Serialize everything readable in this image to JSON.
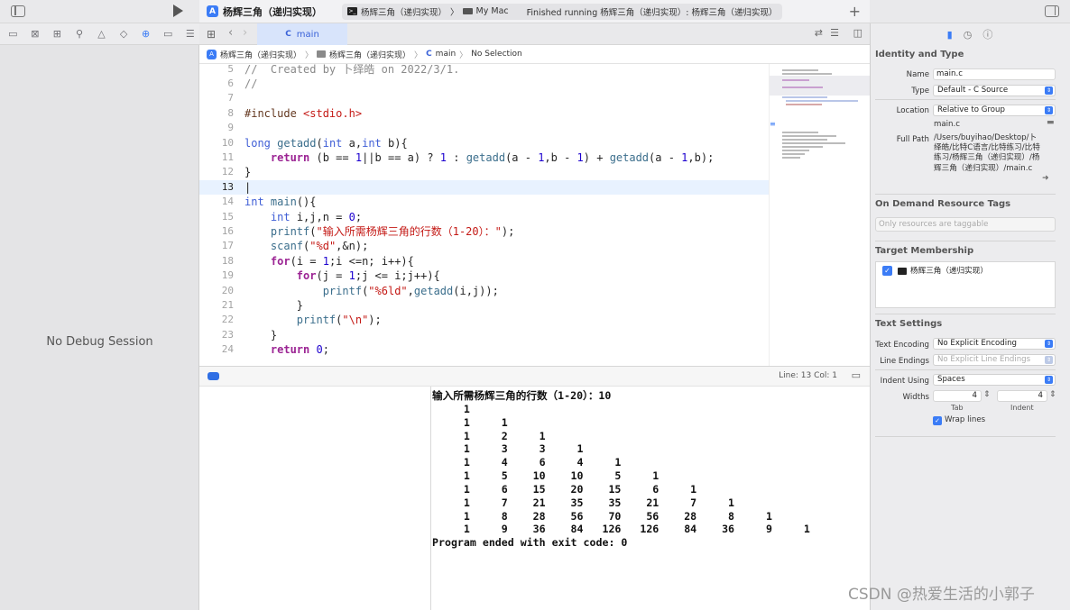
{
  "toolbar": {
    "project_name": "杨辉三角（递归实现）",
    "scheme_target": "杨辉三角（递归实现）",
    "device": "My Mac",
    "status": "Finished running 杨辉三角（递归实现）: 杨辉三角（递归实现）"
  },
  "left_panel": {
    "no_debug": "No Debug Session"
  },
  "tab": {
    "label": "main"
  },
  "jump_bar": {
    "project": "杨辉三角（递归实现）",
    "group": "杨辉三角（递归实现）",
    "file": "main",
    "selection": "No Selection"
  },
  "code_lines": [
    {
      "n": "5",
      "html": "<span class=\"cmt\">//  Created by 卜绎皓 on 2022/3/1.</span>"
    },
    {
      "n": "6",
      "html": "<span class=\"cmt\">//</span>"
    },
    {
      "n": "7",
      "html": ""
    },
    {
      "n": "8",
      "html": "<span class=\"pre\">#include </span><span class=\"str\">&lt;stdio.h&gt;</span>"
    },
    {
      "n": "9",
      "html": ""
    },
    {
      "n": "10",
      "html": "<span class=\"kw2\">long</span> <span class=\"fn\">getadd</span>(<span class=\"kw2\">int</span> a,<span class=\"kw2\">int</span> b){"
    },
    {
      "n": "11",
      "html": "    <span class=\"kw\">return</span> (b == <span class=\"num\">1</span>||b == a) ? <span class=\"num\">1</span> : <span class=\"fn\">getadd</span>(a - <span class=\"num\">1</span>,b - <span class=\"num\">1</span>) + <span class=\"fn\">getadd</span>(a - <span class=\"num\">1</span>,b);"
    },
    {
      "n": "12",
      "html": "}"
    },
    {
      "n": "13",
      "html": "|"
    },
    {
      "n": "14",
      "html": "<span class=\"kw2\">int</span> <span class=\"fn\">main</span>(){"
    },
    {
      "n": "15",
      "html": "    <span class=\"kw2\">int</span> i,j,n = <span class=\"num\">0</span>;"
    },
    {
      "n": "16",
      "html": "    <span class=\"fn\">printf</span>(<span class=\"str\">\"输入所需杨辉三角的行数（1-20）：\"</span>);"
    },
    {
      "n": "17",
      "html": "    <span class=\"fn\">scanf</span>(<span class=\"str\">\"%d\"</span>,&amp;n);"
    },
    {
      "n": "18",
      "html": "    <span class=\"kw\">for</span>(i = <span class=\"num\">1</span>;i &lt;=n; i++){"
    },
    {
      "n": "19",
      "html": "        <span class=\"kw\">for</span>(j = <span class=\"num\">1</span>;j &lt;= i;j++){"
    },
    {
      "n": "20",
      "html": "            <span class=\"fn\">printf</span>(<span class=\"str\">\"%6ld\"</span>,<span class=\"fn\">getadd</span>(i,j));"
    },
    {
      "n": "21",
      "html": "        }"
    },
    {
      "n": "22",
      "html": "        <span class=\"fn\">printf</span>(<span class=\"str\">\"\\n\"</span>);"
    },
    {
      "n": "23",
      "html": "    }"
    },
    {
      "n": "24",
      "html": "    <span class=\"kw\">return</span> <span class=\"num\">0</span>;"
    }
  ],
  "status_bar": {
    "line_col": "Line: 13  Col: 1"
  },
  "console_output": "输入所需杨辉三角的行数（1-20）：10\n     1\n     1     1\n     1     2     1\n     1     3     3     1\n     1     4     6     4     1\n     1     5    10    10     5     1\n     1     6    15    20    15     6     1\n     1     7    21    35    35    21     7     1\n     1     8    28    56    70    56    28     8     1\n     1     9    36    84   126   126    84    36     9     1\nProgram ended with exit code: 0",
  "inspector": {
    "identity_head": "Identity and Type",
    "name_label": "Name",
    "name_value": "main.c",
    "type_label": "Type",
    "type_value": "Default - C Source",
    "location_label": "Location",
    "location_value": "Relative to Group",
    "location_file": "main.c",
    "full_path_label": "Full Path",
    "full_path_value": "/Users/buyihao/Desktop/卜绎皓/比特C语言/比特练习/比特练习/杨辉三角（递归实现）/杨辉三角（递归实现）/main.c",
    "odr_head": "On Demand Resource Tags",
    "odr_placeholder": "Only resources are taggable",
    "target_head": "Target Membership",
    "target_item": "杨辉三角（递归实现）",
    "text_head": "Text Settings",
    "encoding_label": "Text Encoding",
    "encoding_value": "No Explicit Encoding",
    "endings_label": "Line Endings",
    "endings_value": "No Explicit Line Endings",
    "indent_label": "Indent Using",
    "indent_value": "Spaces",
    "widths_label": "Widths",
    "tab_width": "4",
    "indent_width": "4",
    "tab_caption": "Tab",
    "indent_caption": "Indent",
    "wrap_label": "Wrap lines"
  },
  "watermark": "CSDN @热爱生活的小郭子",
  "colors": {
    "accent": "#3b7cf6",
    "keyword": "#9b2393",
    "string": "#c41a16",
    "number": "#1c00cf"
  }
}
